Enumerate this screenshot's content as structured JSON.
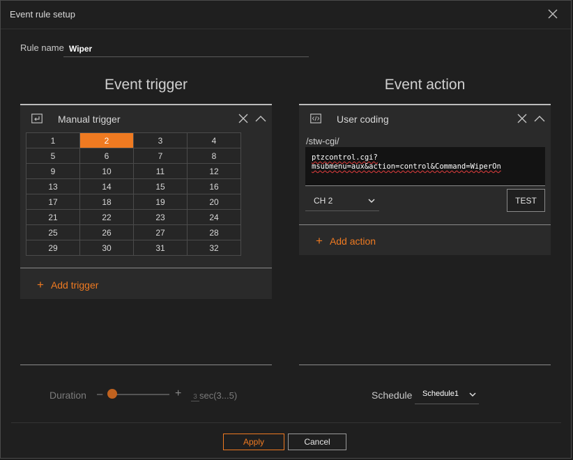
{
  "window": {
    "title": "Event rule setup"
  },
  "rule": {
    "label": "Rule name",
    "value": "Wiper"
  },
  "trigger": {
    "section_title": "Event trigger",
    "panel_label": "Manual trigger",
    "selected": "2",
    "rows": [
      [
        "1",
        "2",
        "3",
        "4"
      ],
      [
        "5",
        "6",
        "7",
        "8"
      ],
      [
        "9",
        "10",
        "11",
        "12"
      ],
      [
        "13",
        "14",
        "15",
        "16"
      ],
      [
        "17",
        "18",
        "19",
        "20"
      ],
      [
        "21",
        "22",
        "23",
        "24"
      ],
      [
        "25",
        "26",
        "27",
        "28"
      ],
      [
        "29",
        "30",
        "31",
        "32"
      ]
    ],
    "add_label": "Add trigger"
  },
  "action": {
    "section_title": "Event action",
    "panel_label": "User coding",
    "path": "/stw-cgi/",
    "code_line1": "ptzcontrol.cgi?",
    "code_line2": "msubmenu=aux&action=control&Command=WiperOn",
    "channel": "CH 2",
    "test_label": "TEST",
    "add_label": "Add action"
  },
  "duration": {
    "label": "Duration",
    "minus": "–",
    "plus": "+",
    "value": "3",
    "unit": "sec(3...5)"
  },
  "schedule": {
    "label": "Schedule",
    "value": "Schedule1"
  },
  "buttons": {
    "apply": "Apply",
    "cancel": "Cancel"
  },
  "colors": {
    "accent": "#ef7a21",
    "background": "#1f1f1f",
    "panel": "#2a2a2a"
  }
}
